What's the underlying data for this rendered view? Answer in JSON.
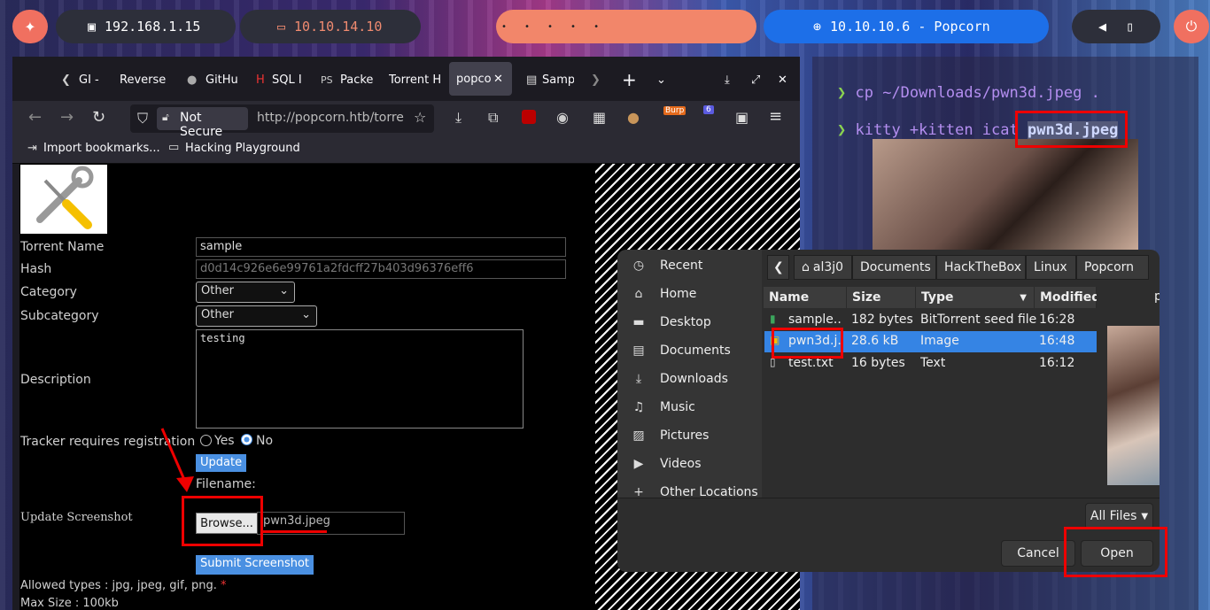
{
  "topbar": {
    "ip_local": "192.168.1.15",
    "ip_vpn": "10.10.14.10",
    "target": "10.10.10.6 - Popcorn"
  },
  "browser": {
    "tabs": [
      "GI -",
      "Reverse",
      "GitHu",
      "SQL I",
      "Packe",
      "Torrent H",
      "popcorn",
      "Samp"
    ],
    "not_secure": "Not Secure",
    "url": "http://popcorn.htb/torren",
    "bookmarks": [
      "Import bookmarks...",
      "Hacking Playground"
    ],
    "ext_badge_burp": "Burp",
    "ext_badge_count": "6"
  },
  "form": {
    "torrent_name_label": "Torrent Name",
    "torrent_name_value": "sample",
    "hash_label": "Hash",
    "hash_value": "d0d14c926e6e99761a2fdcff27b403d96376eff6",
    "category_label": "Category",
    "category_value": "Other",
    "subcategory_label": "Subcategory",
    "subcategory_value": "Other",
    "description_label": "Description",
    "description_value": "testing",
    "tracker_label": "Tracker requires registration",
    "yes_label": "Yes",
    "no_label": "No",
    "update_button": "Update",
    "filename_label": "Filename:",
    "update_screenshot_label": "Update Screenshot",
    "browse_button": "Browse...",
    "file_value": "pwn3d.jpeg",
    "submit_button": "Submit Screenshot",
    "allowed_types": "Allowed types : jpg, jpeg, gif, png.",
    "required_mark": "*",
    "max_size": "Max Size : 100kb"
  },
  "terminal": {
    "prompt": "❯",
    "cmd1": "cp ~/Downloads/pwn3d.jpeg .",
    "cmd2_prefix": "kitty +kitten icat",
    "cmd2_file": "pwn3d.jpeg"
  },
  "dialog": {
    "places": [
      "Recent",
      "Home",
      "Desktop",
      "Documents",
      "Downloads",
      "Music",
      "Pictures",
      "Videos",
      "Other Locations"
    ],
    "breadcrumbs": [
      "al3j0",
      "Documents",
      "HackTheBox",
      "Linux",
      "Popcorn"
    ],
    "columns": [
      "Name",
      "Size",
      "Type",
      "Modified"
    ],
    "files": [
      {
        "name": "sample....",
        "size": "182 bytes",
        "type": "BitTorrent seed file",
        "modified": "16:28"
      },
      {
        "name": "pwn3d.j...",
        "size": "28.6 kB",
        "type": "Image",
        "modified": "16:48"
      },
      {
        "name": "test.txt",
        "size": "16 bytes",
        "type": "Text",
        "modified": "16:12"
      }
    ],
    "preview_label": "p",
    "filter": "All Files",
    "cancel": "Cancel",
    "open": "Open"
  }
}
